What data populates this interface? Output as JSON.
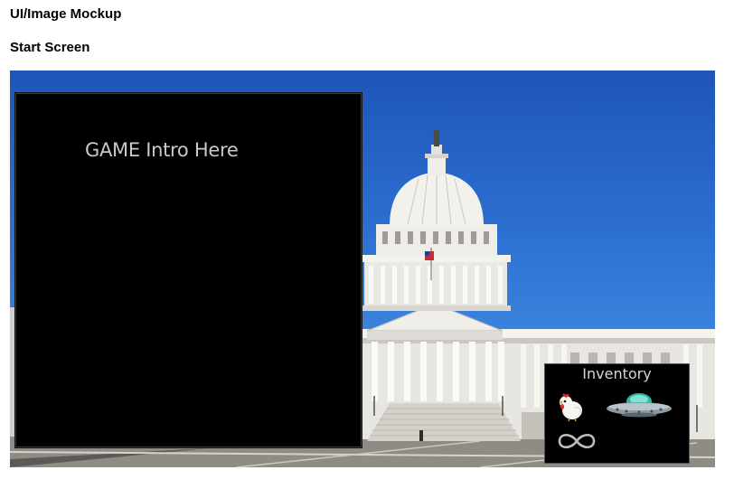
{
  "document": {
    "title": "UI/Image Mockup",
    "subtitle": "Start Screen"
  },
  "game": {
    "intro_text": "GAME Intro Here",
    "inventory": {
      "title": "Inventory",
      "items": [
        {
          "icon": "chicken-icon"
        },
        {
          "icon": "ufo-icon"
        },
        {
          "icon": "infinity-icon"
        }
      ]
    }
  },
  "colors": {
    "sky": "#2c6fd1",
    "panel": "#000000",
    "panel_text": "#c9c9c9"
  }
}
